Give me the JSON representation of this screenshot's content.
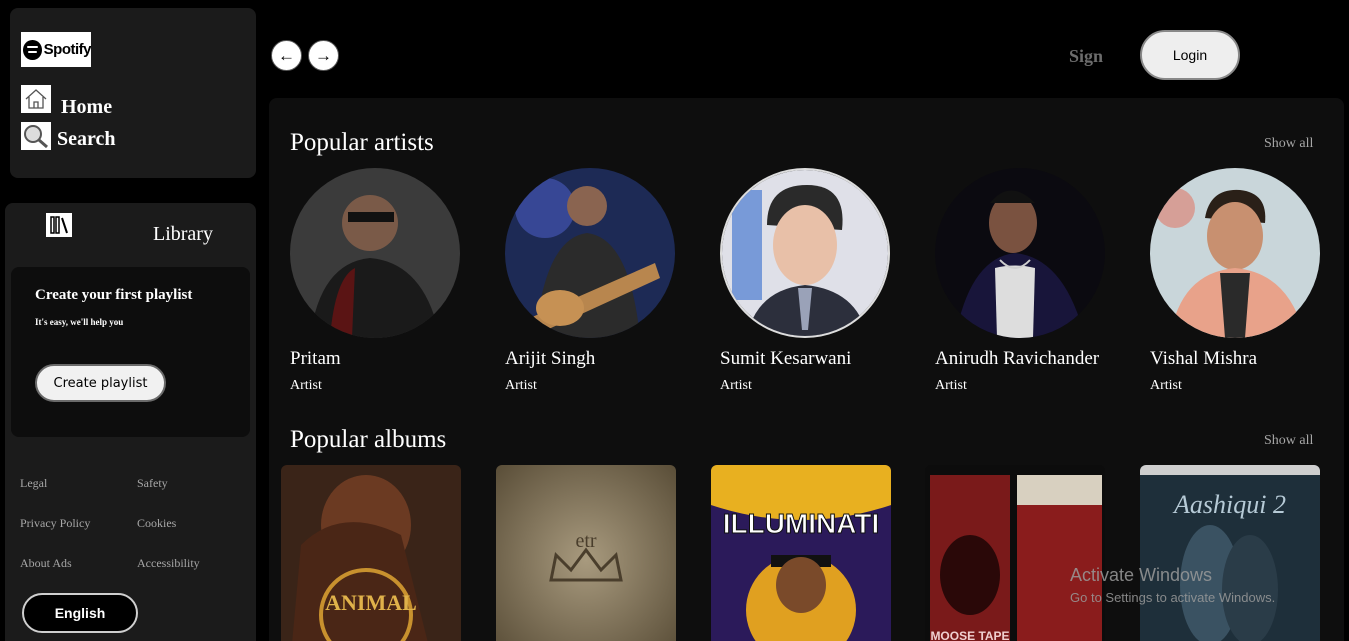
{
  "brand": {
    "logo_text": "Spotify"
  },
  "nav": {
    "home": "Home",
    "search": "Search"
  },
  "library": {
    "title": "Library",
    "card_title": "Create your first playlist",
    "card_subtitle": "It's easy, we'll help you",
    "create_button": "Create playlist"
  },
  "footer_links": [
    "Legal",
    "Safety",
    "Privacy Policy",
    "Cookies",
    "About Ads",
    "Accessibility"
  ],
  "language_button": "English",
  "header": {
    "back_arrow": "←",
    "forward_arrow": "→",
    "sign": "Sign",
    "login": "Login"
  },
  "sections": {
    "artists_title": "Popular artists",
    "albums_title": "Popular albums",
    "show_all": "Show all"
  },
  "artists": [
    {
      "name": "Pritam",
      "type": "Artist"
    },
    {
      "name": "Arijit Singh",
      "type": "Artist"
    },
    {
      "name": "Sumit Kesarwani",
      "type": "Artist"
    },
    {
      "name": "Anirudh Ravichander",
      "type": "Artist"
    },
    {
      "name": "Vishal Mishra",
      "type": "Artist"
    }
  ],
  "albums": [
    {
      "title": "ANIMAL"
    },
    {
      "title": "etr"
    },
    {
      "title": "ILLUMINATI"
    },
    {
      "title": "MOOSE TAPE"
    },
    {
      "title": "Aashiqui 2"
    }
  ],
  "watermark": {
    "line1": "Activate Windows",
    "line2": "Go to Settings to activate Windows."
  }
}
